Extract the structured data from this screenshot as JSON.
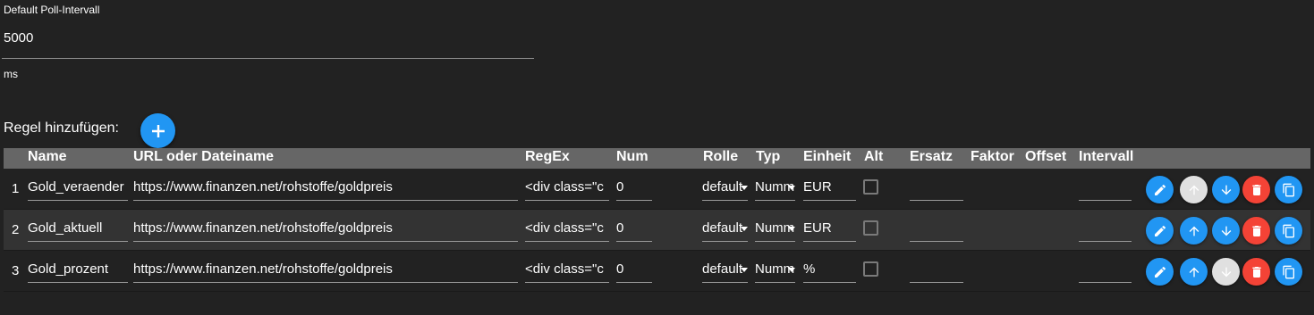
{
  "poll": {
    "label": "Default Poll-Intervall",
    "value": "5000",
    "unit": "ms"
  },
  "add_rule": {
    "label": "Regel hinzufügen:"
  },
  "columns": [
    "Name",
    "URL oder Dateiname",
    "RegEx",
    "Num",
    "Rolle",
    "Typ",
    "Einheit",
    "Alt",
    "Ersatz",
    "Faktor",
    "Offset",
    "Intervall"
  ],
  "rows": [
    {
      "index": "1",
      "name": "Gold_veraender",
      "url": "https://www.finanzen.net/rohstoffe/goldpreis",
      "regex": "<div class=\"c",
      "num": "0",
      "rolle": "default",
      "typ": "Numm",
      "einheit": "EUR",
      "ersatz": "",
      "intervall": "",
      "up_disabled": true,
      "down_disabled": false
    },
    {
      "index": "2",
      "name": "Gold_aktuell",
      "url": "https://www.finanzen.net/rohstoffe/goldpreis",
      "regex": "<div class=\"c",
      "num": "0",
      "rolle": "default",
      "typ": "Numm",
      "einheit": "EUR",
      "ersatz": "",
      "intervall": "",
      "up_disabled": false,
      "down_disabled": false
    },
    {
      "index": "3",
      "name": "Gold_prozent",
      "url": "https://www.finanzen.net/rohstoffe/goldpreis",
      "regex": "<div class=\"c",
      "num": "0",
      "rolle": "default",
      "typ": "Numm",
      "einheit": "%",
      "ersatz": "",
      "intervall": "",
      "up_disabled": false,
      "down_disabled": true
    }
  ],
  "colors": {
    "accent": "#2196f3",
    "danger": "#f44336",
    "disabled": "#e0e0e0",
    "header_bg": "#666666"
  },
  "icons": {
    "add": "plus-icon",
    "edit": "pencil-icon",
    "up": "arrow-up-icon",
    "down": "arrow-down-icon",
    "delete": "trash-icon",
    "copy": "copy-icon"
  }
}
